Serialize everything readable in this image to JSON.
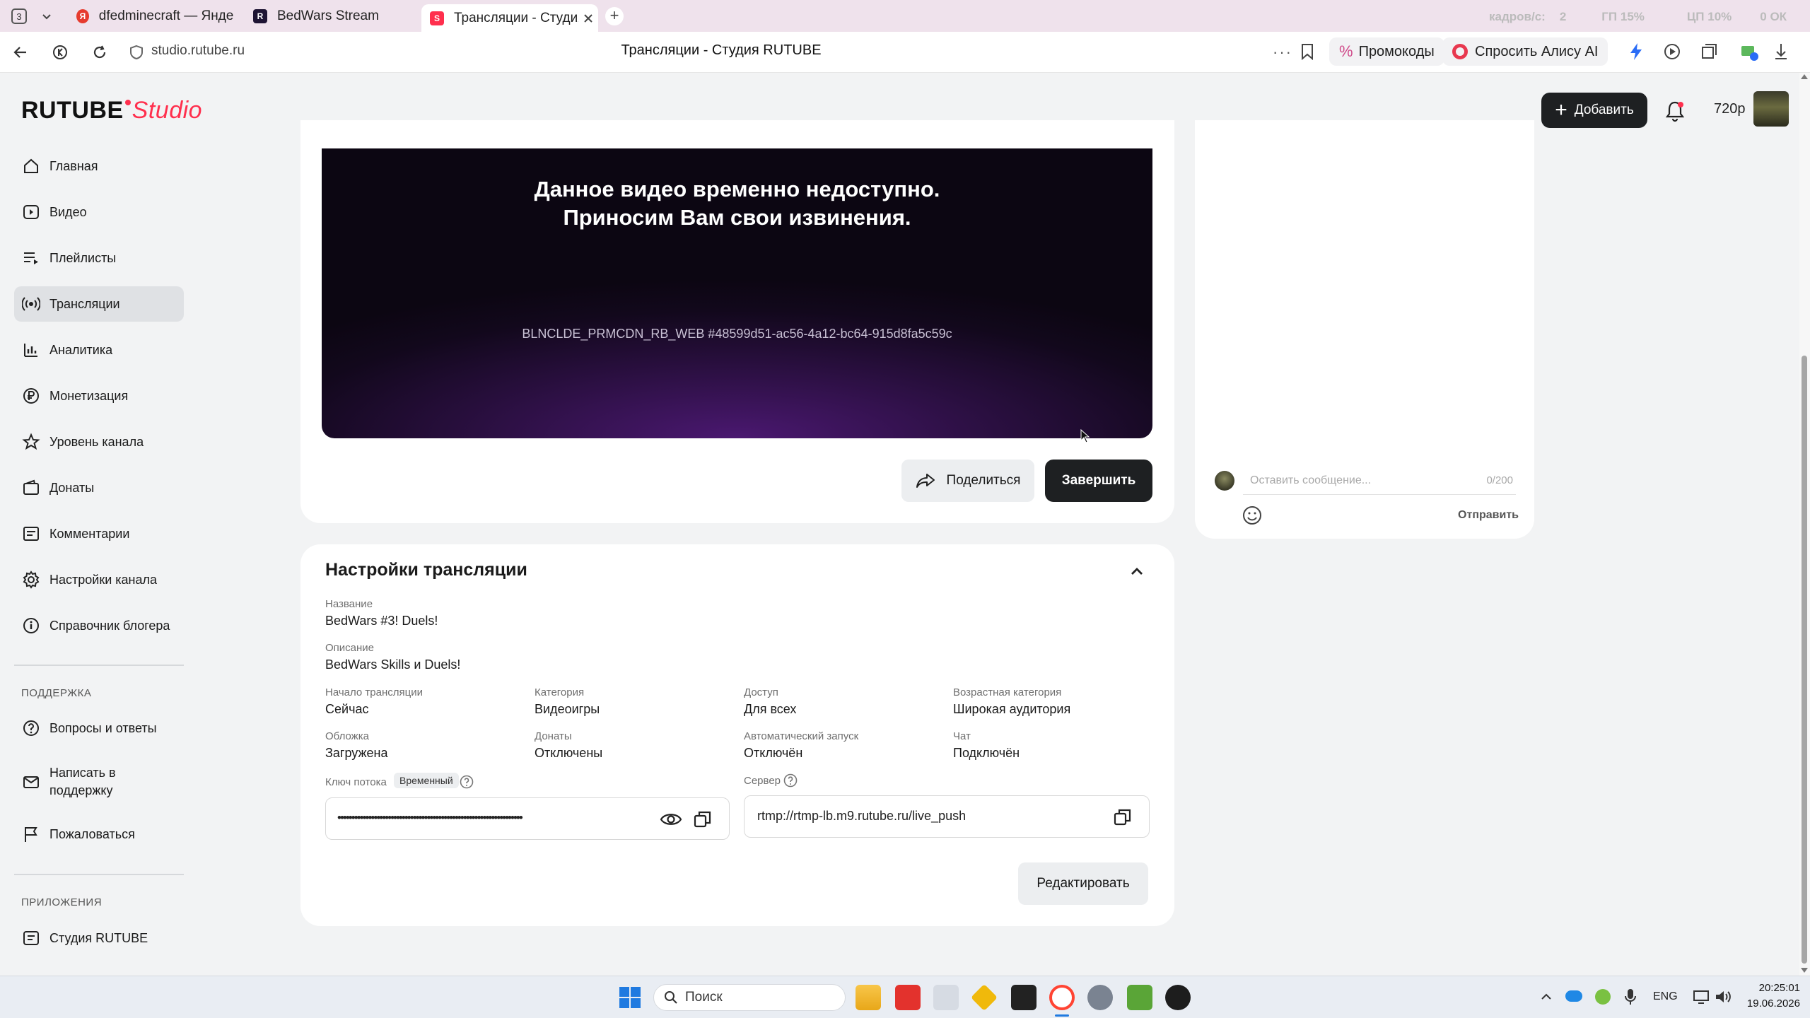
{
  "browser": {
    "tab_count": "3",
    "tabs": [
      {
        "title": "dfedminecraft — Яндекс:"
      },
      {
        "title": "BedWars Stream"
      },
      {
        "title": "Трансляции - Студия R"
      }
    ],
    "new_tab_symbol": "+",
    "overlay_stats": [
      "кадров/с:",
      "2",
      "ГП 15%",
      "ЦП 10%",
      "0 ОК"
    ],
    "url": "studio.rutube.ru",
    "page_title": "Трансляции - Студия RUTUBE",
    "promo_label": "Промокоды",
    "alice_label": "Спросить Алису AI"
  },
  "app": {
    "logo_main": "RUTUBE",
    "logo_accent": "Studio",
    "add_button": "Добавить",
    "quality": "720p",
    "accent_color": "#ff2f4d"
  },
  "sidebar": {
    "items": [
      {
        "label": "Главная",
        "icon": "home-icon"
      },
      {
        "label": "Видео",
        "icon": "video-icon"
      },
      {
        "label": "Плейлисты",
        "icon": "playlist-icon"
      },
      {
        "label": "Трансляции",
        "icon": "broadcast-icon"
      },
      {
        "label": "Аналитика",
        "icon": "analytics-icon"
      },
      {
        "label": "Монетизация",
        "icon": "ruble-icon"
      },
      {
        "label": "Уровень канала",
        "icon": "star-icon"
      },
      {
        "label": "Донаты",
        "icon": "wallet-icon"
      },
      {
        "label": "Комментарии",
        "icon": "comment-icon"
      },
      {
        "label": "Настройки канала",
        "icon": "gear-icon"
      },
      {
        "label": "Справочник блогера",
        "icon": "info-icon"
      }
    ],
    "support_title": "ПОДДЕРЖКА",
    "support_items": [
      {
        "label": "Вопросы и ответы",
        "icon": "question-icon"
      },
      {
        "label_line1": "Написать в",
        "label_line2": "поддержку",
        "icon": "mail-icon"
      },
      {
        "label": "Пожаловаться",
        "icon": "flag-icon"
      }
    ],
    "apps_title": "ПРИЛОЖЕНИЯ",
    "apps_items": [
      {
        "label": "Студия RUTUBE",
        "icon": "studio-icon"
      }
    ]
  },
  "player": {
    "message_line1": "Данное видео временно недоступно.",
    "message_line2": "Приносим Вам свои извинения.",
    "error_code": "BLNCLDE_PRMCDN_RB_WEB #48599d51-ac56-4a12-bc64-915d8fa5c59c",
    "share_button": "Поделиться",
    "finish_button": "Завершить"
  },
  "chat": {
    "placeholder": "Оставить сообщение...",
    "counter": "0/200",
    "send_button": "Отправить"
  },
  "settings": {
    "title": "Настройки трансляции",
    "name_label": "Название",
    "name_value": "BedWars #3! Duels!",
    "desc_label": "Описание",
    "desc_value": "BedWars Skills и Duels!",
    "start_label": "Начало трансляции",
    "start_value": "Сейчас",
    "category_label": "Категория",
    "category_value": "Видеоигры",
    "access_label": "Доступ",
    "access_value": "Для всех",
    "age_label": "Возрастная категория",
    "age_value": "Широкая аудитория",
    "cover_label": "Обложка",
    "cover_value": "Загружена",
    "donations_label": "Донаты",
    "donations_value": "Отключены",
    "autostart_label": "Автоматический запуск",
    "autostart_value": "Отключён",
    "chat_label": "Чат",
    "chat_value": "Подключён",
    "key_label": "Ключ потока",
    "key_badge": "Временный",
    "key_value": "••••••••••••••••••••••••••••••••••••••••••••••••••••••••••••••••••",
    "server_label": "Сервер",
    "server_value": "rtmp://rtmp-lb.m9.rutube.ru/live_push",
    "edit_button": "Редактировать"
  },
  "taskbar": {
    "search_label": "Поиск",
    "language": "ENG",
    "time": "20:25:01",
    "date": "19.06.2026"
  }
}
